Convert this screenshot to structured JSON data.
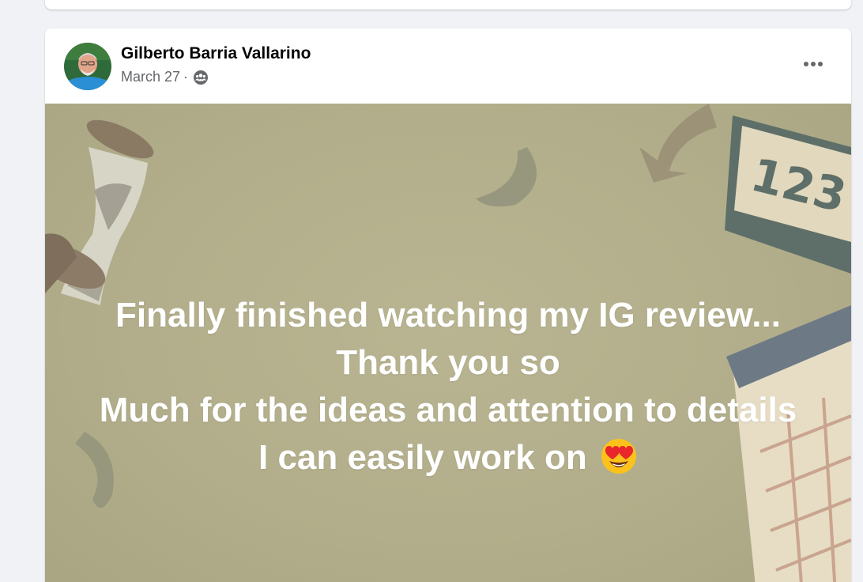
{
  "post": {
    "author": "Gilberto Barria Vallarino",
    "date": "March 27",
    "separator": "·",
    "audience_icon": "friends-icon",
    "more_icon": "more-options-icon",
    "text_lines": [
      "Finally finished watching my IG review...",
      "Thank you so",
      "Much for the ideas and attention to details",
      "I can easily work on"
    ],
    "emoji": "heart-eyes-emoji",
    "colors": {
      "background_card": "#b2ae8b",
      "text": "#ffffff",
      "meta": "#65676b"
    }
  }
}
